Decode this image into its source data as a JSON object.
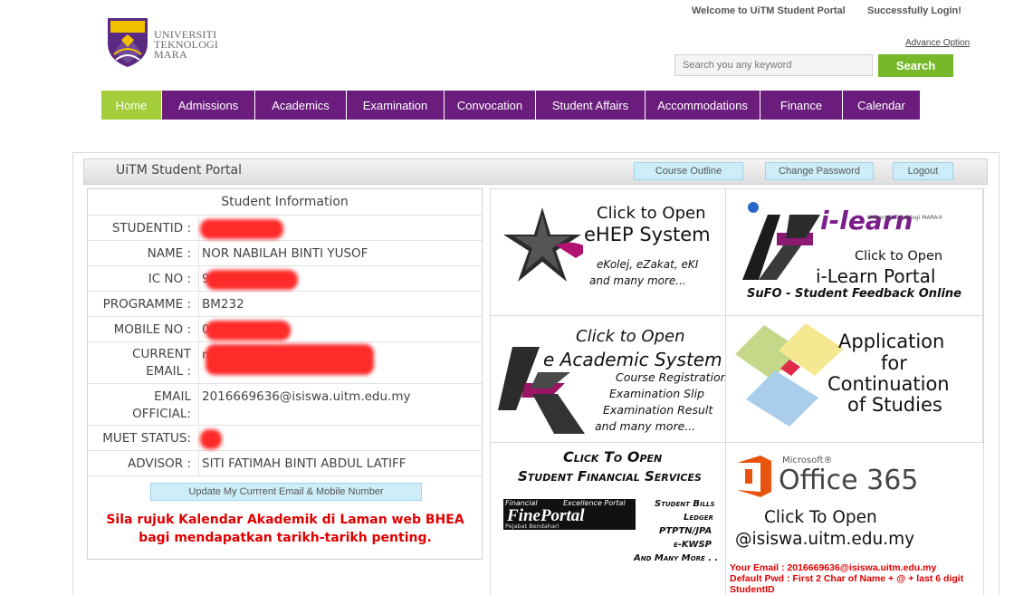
{
  "header": {
    "logo_lines": [
      "UNIVERSITI",
      "TEKNOLOGI",
      "MARA"
    ],
    "welcome": "Welcome to UiTM Student Portal",
    "status": "Successfully Login!",
    "advance_option": "Advance Option",
    "search_placeholder": "Search you any keyword",
    "search_button": "Search"
  },
  "nav": {
    "items": [
      {
        "label": "Home",
        "active": true
      },
      {
        "label": "Admissions"
      },
      {
        "label": "Academics"
      },
      {
        "label": "Examination"
      },
      {
        "label": "Convocation"
      },
      {
        "label": "Student Affairs"
      },
      {
        "label": "Accommodations"
      },
      {
        "label": "Finance"
      },
      {
        "label": "Calendar"
      }
    ]
  },
  "portal": {
    "title": "UiTM Student Portal",
    "course_outline": "Course Outline",
    "change_password": "Change Password",
    "logout": "Logout"
  },
  "student_info": {
    "heading": "Student Information",
    "rows": [
      {
        "label": "STUDENTID :",
        "value": ""
      },
      {
        "label": "NAME :",
        "value": "NOR NABILAH BINTI YUSOF"
      },
      {
        "label": "IC NO :",
        "value": "9"
      },
      {
        "label": "PROGRAMME :",
        "value": "BM232"
      },
      {
        "label": "MOBILE NO :",
        "value": "0"
      },
      {
        "label": "CURRENT EMAIL :",
        "label_line1": "CURRENT",
        "label_line2": "EMAIL :",
        "value": "n"
      },
      {
        "label": "EMAIL OFFICIAL:",
        "label_line1": "EMAIL",
        "label_line2": "OFFICIAL:",
        "value": "2016669636@isiswa.uitm.edu.my"
      },
      {
        "label": "MUET STATUS:",
        "value": ""
      },
      {
        "label": "ADVISOR :",
        "value": "SITI FATIMAH BINTI ABDUL LATIFF"
      }
    ],
    "update_button": "Update My Currrent Email & Mobile Number",
    "notice": "Sila rujuk Kalendar Akademik di Laman web BHEA bagi mendapatkan tarikh-tarikh penting."
  },
  "tiles": {
    "ehep": {
      "line1": "Click to Open",
      "line2": "eHEP System",
      "line3": "eKolej, eZakat, eKI",
      "line4": "and many more..."
    },
    "ilearn": {
      "brand": "i-learn",
      "tag": "Universiti Teknologi MARA®",
      "line1": "Click to Open",
      "line2": "i-Learn Portal",
      "line3": "SuFO - Student Feedback Online"
    },
    "eacademic": {
      "line1": "Click to Open",
      "line2": "e Academic System",
      "line3": "Course Registration",
      "line4": "Examination Slip",
      "line5": "Examination Result",
      "line6": "and many more..."
    },
    "continuation": {
      "line1": "Application",
      "line2": "for",
      "line3": "Continuation",
      "line4": "of Studies"
    },
    "finance": {
      "line1": "Click To Open",
      "line2": "Student Financial Services",
      "logo_top_left": "Financial",
      "logo_top_right": "Excellence Portal",
      "logo_main": "FinePortal",
      "logo_sub": "Pejabat Bendahari",
      "items": [
        "Student Bills",
        "Ledger",
        "PTPTN/JPA",
        "e-KWSP",
        "And Many More . ."
      ]
    },
    "office": {
      "brand_small": "Microsoft®",
      "brand": "Office 365",
      "line1": "Click To Open",
      "line2": "@isiswa.uitm.edu.my"
    }
  },
  "email_note": {
    "line1": "Your Email : 2016669636@isiswa.uitm.edu.my",
    "line2": "Default Pwd : First 2 Char of Name + @ + last 6 digit",
    "line3": "StudentID"
  },
  "colors": {
    "nav": "#6b1d7d",
    "nav_active": "#a4cd3c",
    "search_button": "#76b82a",
    "notice": "#e00000"
  }
}
